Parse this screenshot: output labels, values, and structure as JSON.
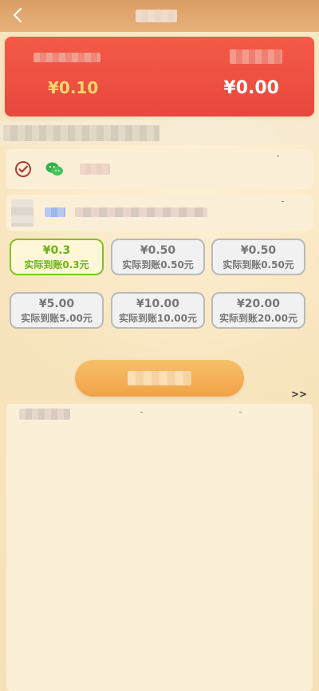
{
  "balance": {
    "left_amount": "¥0.10",
    "right_amount": "¥0.00"
  },
  "amount_options": [
    {
      "amount": "¥0.3",
      "actual": "实际到账0.3元",
      "selected": true
    },
    {
      "amount": "¥0.50",
      "actual": "实际到账0.50元",
      "selected": false
    },
    {
      "amount": "¥0.50",
      "actual": "实际到账0.50元",
      "selected": false
    },
    {
      "amount": "¥5.00",
      "actual": "实际到账5.00元",
      "selected": false
    },
    {
      "amount": "¥10.00",
      "actual": "实际到账10.00元",
      "selected": false
    },
    {
      "amount": "¥20.00",
      "actual": "实际到账20.00元",
      "selected": false
    }
  ],
  "more_label": ">>",
  "colors": {
    "card_red": "#e8473d",
    "accent_green": "#7ec322",
    "button_orange": "#f2a246",
    "panel_beige": "#fbf0d7"
  },
  "icons": {
    "back": "chevron-left-icon",
    "check": "check-circle-icon",
    "wechat": "wechat-icon"
  }
}
